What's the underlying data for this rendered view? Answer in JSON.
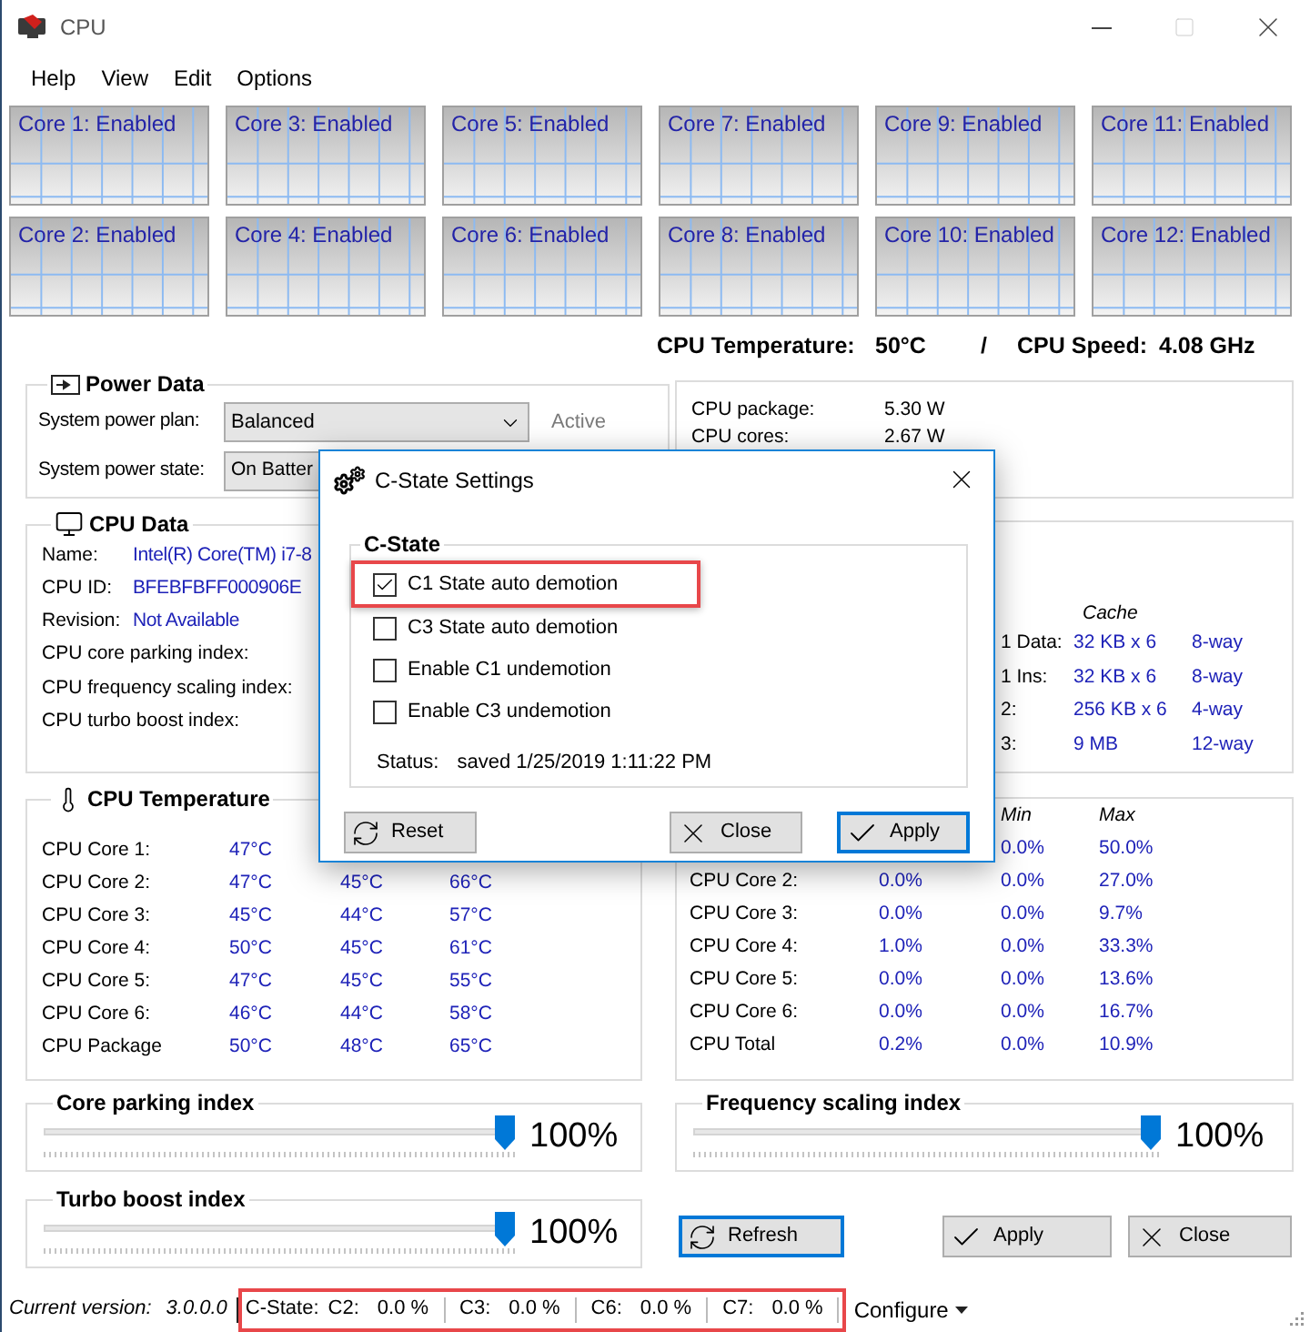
{
  "window": {
    "title": "CPU"
  },
  "menu": [
    "Help",
    "View",
    "Edit",
    "Options"
  ],
  "core_rows": [
    [
      "Core 1: Enabled",
      "Core 3: Enabled",
      "Core 5: Enabled",
      "Core 7: Enabled",
      "Core 9: Enabled",
      "Core 11: Enabled"
    ],
    [
      "Core 2: Enabled",
      "Core 4: Enabled",
      "Core 6: Enabled",
      "Core 8: Enabled",
      "Core 10: Enabled",
      "Core 12: Enabled"
    ]
  ],
  "summary": {
    "temperature_label": "CPU Temperature:",
    "temperature": "50°C",
    "separator": "/",
    "speed_label": "CPU Speed:",
    "speed": "4.08 GHz"
  },
  "power_data": {
    "title": "Power Data",
    "plan_label": "System power plan:",
    "plan": "Balanced",
    "plan_status": "Active",
    "state_label": "System power state:",
    "state": "On Batter",
    "readings": [
      {
        "label": "CPU package:",
        "value": "5.30 W"
      },
      {
        "label": "CPU cores:",
        "value": "2.67 W"
      }
    ]
  },
  "cpu_data": {
    "title": "CPU Data",
    "fields": [
      {
        "label": "Name:",
        "value": "Intel(R) Core(TM) i7-8"
      },
      {
        "label": "CPU ID:",
        "value": "BFEBFBFF000906E"
      },
      {
        "label": "Revision:",
        "value": "Not Available"
      }
    ],
    "indexes": [
      "CPU core parking index:",
      "CPU frequency scaling index:",
      "CPU turbo boost index:"
    ],
    "cache_title": "Cache",
    "cache": [
      [
        "1 Data:",
        "32 KB x 6",
        "8-way"
      ],
      [
        "1 Ins:",
        "32 KB x 6",
        "8-way"
      ],
      [
        "2:",
        "256 KB x 6",
        "4-way"
      ],
      [
        "3:",
        "9 MB",
        "12-way"
      ]
    ]
  },
  "temperature": {
    "title": "CPU Temperature",
    "rows": [
      {
        "name": "CPU Core 1:",
        "current": "47°C"
      },
      {
        "name": "CPU Core 2:",
        "current": "47°C",
        "min": "45°C",
        "max": "66°C"
      },
      {
        "name": "CPU Core 3:",
        "current": "45°C",
        "min": "44°C",
        "max": "57°C"
      },
      {
        "name": "CPU Core 4:",
        "current": "50°C",
        "min": "45°C",
        "max": "61°C"
      },
      {
        "name": "CPU Core 5:",
        "current": "47°C",
        "min": "45°C",
        "max": "55°C"
      },
      {
        "name": "CPU Core 6:",
        "current": "46°C",
        "min": "44°C",
        "max": "58°C"
      },
      {
        "name": "CPU Package",
        "current": "50°C",
        "min": "48°C",
        "max": "65°C"
      }
    ]
  },
  "usage": {
    "min_header": "Min",
    "max_header": "Max",
    "rows": [
      {
        "min": "0.0%",
        "max": "50.0%"
      },
      {
        "name": "CPU Core 2:",
        "current": "0.0%",
        "min": "0.0%",
        "max": "27.0%"
      },
      {
        "name": "CPU Core 3:",
        "current": "0.0%",
        "min": "0.0%",
        "max": "9.7%"
      },
      {
        "name": "CPU Core 4:",
        "current": "1.0%",
        "min": "0.0%",
        "max": "33.3%"
      },
      {
        "name": "CPU Core 5:",
        "current": "0.0%",
        "min": "0.0%",
        "max": "13.6%"
      },
      {
        "name": "CPU Core 6:",
        "current": "0.0%",
        "min": "0.0%",
        "max": "16.7%"
      },
      {
        "name": "CPU Total",
        "current": "0.2%",
        "min": "0.0%",
        "max": "10.9%"
      }
    ]
  },
  "sliders": [
    {
      "label": "Core parking index",
      "level": 1,
      "reading": "100%"
    },
    {
      "label": "Turbo boost index",
      "level": 1,
      "reading": "100%"
    },
    {
      "label": "Frequency scaling index",
      "level": 1,
      "reading": "100%"
    }
  ],
  "actions": [
    {
      "label": "Refresh",
      "kind": "refresh",
      "focused": true
    },
    {
      "label": "Apply",
      "kind": "apply",
      "focused": false
    },
    {
      "label": "Close",
      "kind": "close",
      "focused": false
    }
  ],
  "status_bar": {
    "version_label": "Current version:",
    "version": "3.0.0.0",
    "cstate_label": "C-State:",
    "highlighted": true,
    "cstates": [
      {
        "label": "C2:",
        "value": "0.0 %"
      },
      {
        "label": "C3:",
        "value": "0.0 %"
      },
      {
        "label": "C6:",
        "value": "0.0 %"
      },
      {
        "label": "C7:",
        "value": "0.0 %"
      }
    ],
    "configure": "Configure"
  },
  "dialog": {
    "title": "C-State Settings",
    "group": "C-State",
    "options": [
      {
        "label": "C1 State auto demotion",
        "checked": true,
        "highlighted": true
      },
      {
        "label": "C3 State auto demotion",
        "checked": false,
        "highlighted": false
      },
      {
        "label": "Enable C1 undemotion",
        "checked": false,
        "highlighted": false
      },
      {
        "label": "Enable C3 undemotion",
        "checked": false,
        "highlighted": false
      }
    ],
    "status_label": "Status:",
    "status": "saved 1/25/2019 1:11:22 PM",
    "buttons": [
      {
        "label": "Reset",
        "kind": "reset",
        "focused": false
      },
      {
        "label": "Close",
        "kind": "close",
        "focused": false
      },
      {
        "label": "Apply",
        "kind": "apply",
        "focused": true
      }
    ]
  }
}
